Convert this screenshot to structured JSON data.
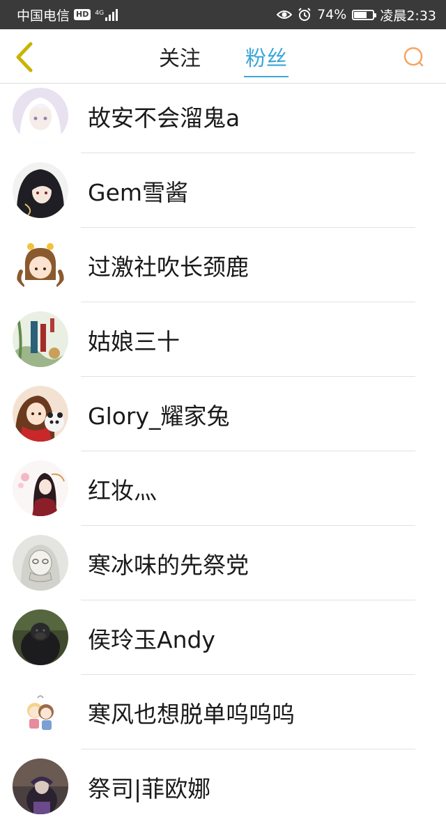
{
  "status_bar": {
    "carrier": "中国电信",
    "hd_badge": "HD",
    "network_type": "4G",
    "battery_percent": "74%",
    "battery_level": 0.74,
    "time": "凌晨2:33"
  },
  "header": {
    "tabs": [
      {
        "label": "关注",
        "active": false
      },
      {
        "label": "粉丝",
        "active": true
      }
    ],
    "accent_color": "#3ba7d8",
    "back_icon_color": "#c9b400",
    "search_icon_color": "#f4a460"
  },
  "fans": [
    {
      "name": "故安不会溜鬼a",
      "avatar_icon": "anime-girl-white-hair-avatar"
    },
    {
      "name": "Gem雪酱",
      "avatar_icon": "anime-dark-hair-avatar"
    },
    {
      "name": "过激社吹长颈鹿",
      "avatar_icon": "cartoon-girl-pigtails-avatar"
    },
    {
      "name": "姑娘三十",
      "avatar_icon": "book-cover-avatar"
    },
    {
      "name": "Glory_耀家兔",
      "avatar_icon": "girl-with-panda-avatar"
    },
    {
      "name": "红妆灬",
      "avatar_icon": "ancient-costume-avatar"
    },
    {
      "name": "寒冰味的先祭党",
      "avatar_icon": "sketch-face-avatar"
    },
    {
      "name": "侯玲玉Andy",
      "avatar_icon": "gorilla-avatar"
    },
    {
      "name": "寒风也想脱单呜呜呜",
      "avatar_icon": "chibi-couple-avatar"
    },
    {
      "name": "祭司|菲欧娜",
      "avatar_icon": "game-character-avatar"
    }
  ]
}
